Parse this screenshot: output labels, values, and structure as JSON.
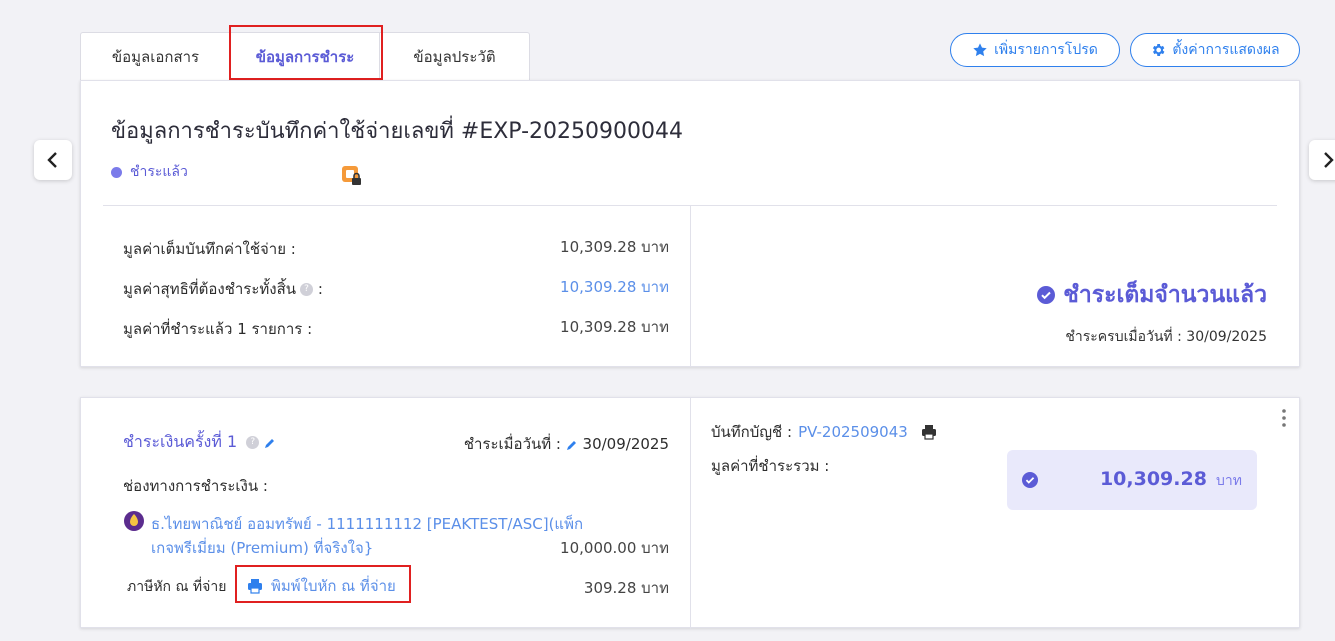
{
  "tabs": [
    {
      "label": "ข้อมูลเอกสาร"
    },
    {
      "label": "ข้อมูลการชำระ"
    },
    {
      "label": "ข้อมูลประวัติ"
    }
  ],
  "actions": {
    "favorite_label": "เพิ่มรายการโปรด",
    "display_settings_label": "ตั้งค่าการแสดงผล"
  },
  "summary": {
    "title": "ข้อมูลการชำระบันทึกค่าใช้จ่ายเลขที่ #EXP-20250900044",
    "status": "ชำระแล้ว",
    "rows": [
      {
        "label": "มูลค่าเต็มบันทึกค่าใช้จ่าย :",
        "value": "10,309.28 บาท"
      },
      {
        "label": "มูลค่าสุทธิที่ต้องชำระทั้งสิ้น",
        "label_suffix": ":",
        "help": "?",
        "value": "10,309.28 บาท"
      },
      {
        "label": "มูลค่าที่ชำระแล้ว 1 รายการ :",
        "value": "10,309.28 บาท"
      }
    ],
    "paid_full": "ชำระเต็มจำนวนแล้ว",
    "paid_on_label": "ชำระครบเมื่อวันที่ :",
    "paid_on_date": "30/09/2025"
  },
  "payment": {
    "title": "ชำระเงินครั้งที่ 1",
    "help": "?",
    "paid_date_label": "ชำระเมื่อวันที่ :",
    "paid_date": "30/09/2025",
    "channel_label": "ช่องทางการชำระเงิน :",
    "bank_line1": "ธ.ไทยพาณิชย์ ออมทรัพย์ - 1111111112 [PEAKTEST/ASC](แพ็ก",
    "bank_line2": "เกจพรีเมี่ยม (Premium) ที่จริงใจ}",
    "bank_amount": "10,000.00 บาท",
    "wht_label": "ภาษีหัก ณ ที่จ่าย",
    "print_wht_label": "พิมพ์ใบหัก ณ ที่จ่าย",
    "wht_amount": "309.28 บาท",
    "voucher_label": "บันทึกบัญชี :",
    "voucher_no": "PV-202509043",
    "total_label": "มูลค่าที่ชำระรวม :",
    "total_amount": "10,309.28",
    "total_unit": "บาท"
  },
  "colors": {
    "accent": "#5b5bd6",
    "link": "#5b8fe8",
    "button": "#2f80ed",
    "highlight": "#e02020"
  }
}
